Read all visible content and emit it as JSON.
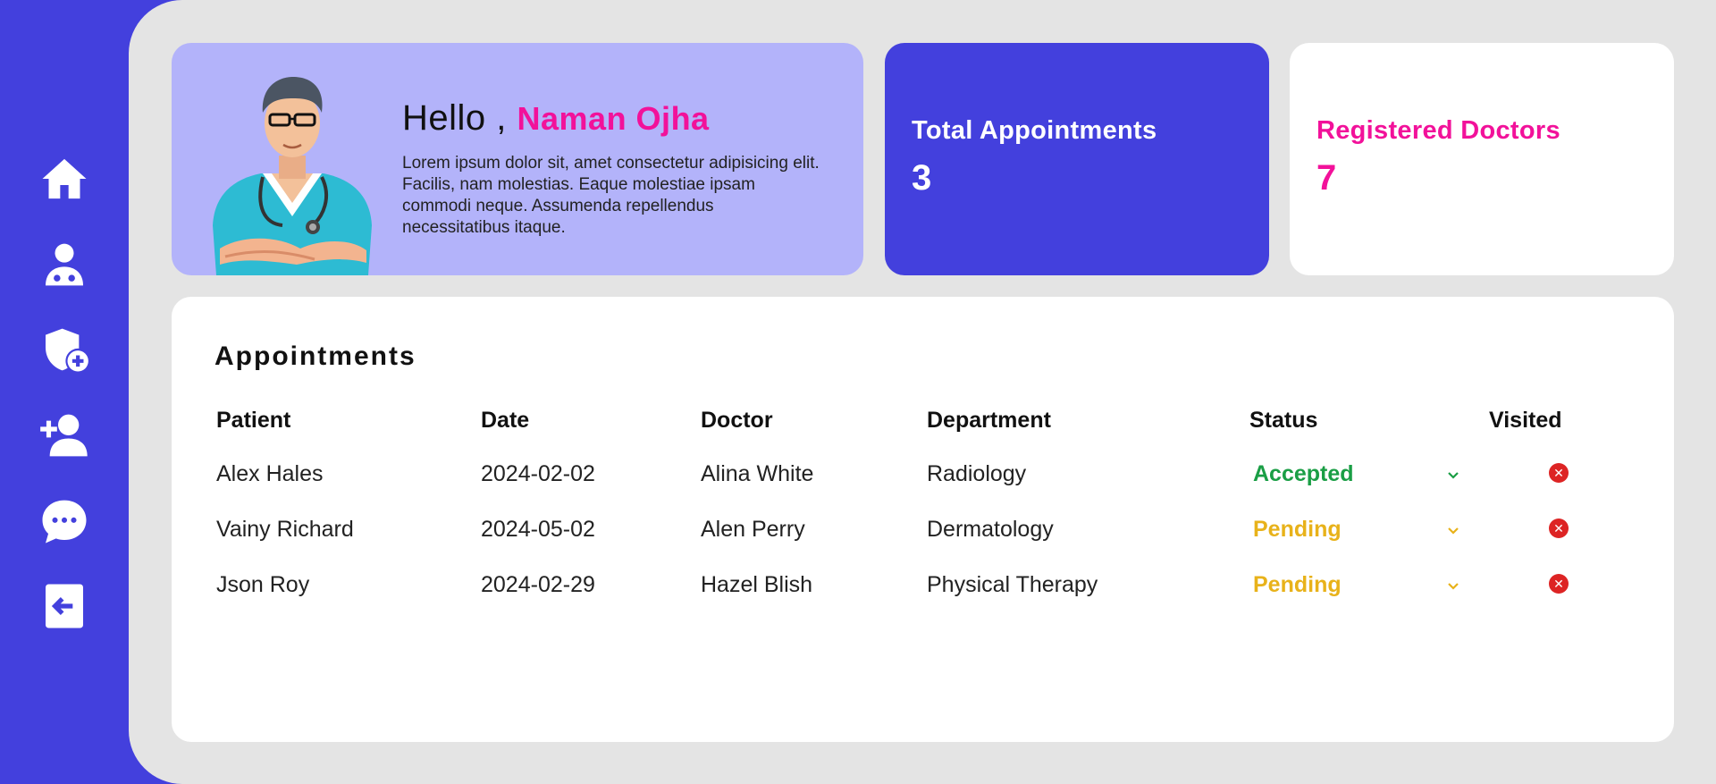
{
  "sidebar": {
    "items": [
      {
        "icon": "home-icon"
      },
      {
        "icon": "doctor-icon"
      },
      {
        "icon": "shield-plus-icon"
      },
      {
        "icon": "add-user-icon"
      },
      {
        "icon": "chat-icon"
      },
      {
        "icon": "logout-icon"
      }
    ]
  },
  "hero": {
    "greeting": "Hello ,",
    "name": "Naman Ojha",
    "description": "Lorem ipsum dolor sit, amet consectetur adipisicing elit. Facilis, nam molestias. Eaque molestiae ipsam commodi neque. Assumenda repellendus necessitatibus itaque."
  },
  "stats": {
    "appointments": {
      "label": "Total Appointments",
      "value": "3"
    },
    "doctors": {
      "label": "Registered Doctors",
      "value": "7"
    }
  },
  "appointments": {
    "title": "Appointments",
    "columns": [
      "Patient",
      "Date",
      "Doctor",
      "Department",
      "Status",
      "Visited"
    ],
    "rows": [
      {
        "patient": "Alex Hales",
        "date": "2024-02-02",
        "doctor": "Alina White",
        "department": "Radiology",
        "status": "Accepted",
        "status_color": "#1a9e45",
        "visited": false
      },
      {
        "patient": "Vainy Richard",
        "date": "2024-05-02",
        "doctor": "Alen Perry",
        "department": "Dermatology",
        "status": "Pending",
        "status_color": "#e8b21a",
        "visited": false
      },
      {
        "patient": "Json Roy",
        "date": "2024-02-29",
        "doctor": "Hazel Blish",
        "department": "Physical Therapy",
        "status": "Pending",
        "status_color": "#e8b21a",
        "visited": false
      }
    ]
  },
  "colors": {
    "primary": "#4340dd",
    "accent": "#f2119a",
    "hero_bg": "#b3b3fa",
    "not_visited": "#dd2424"
  }
}
